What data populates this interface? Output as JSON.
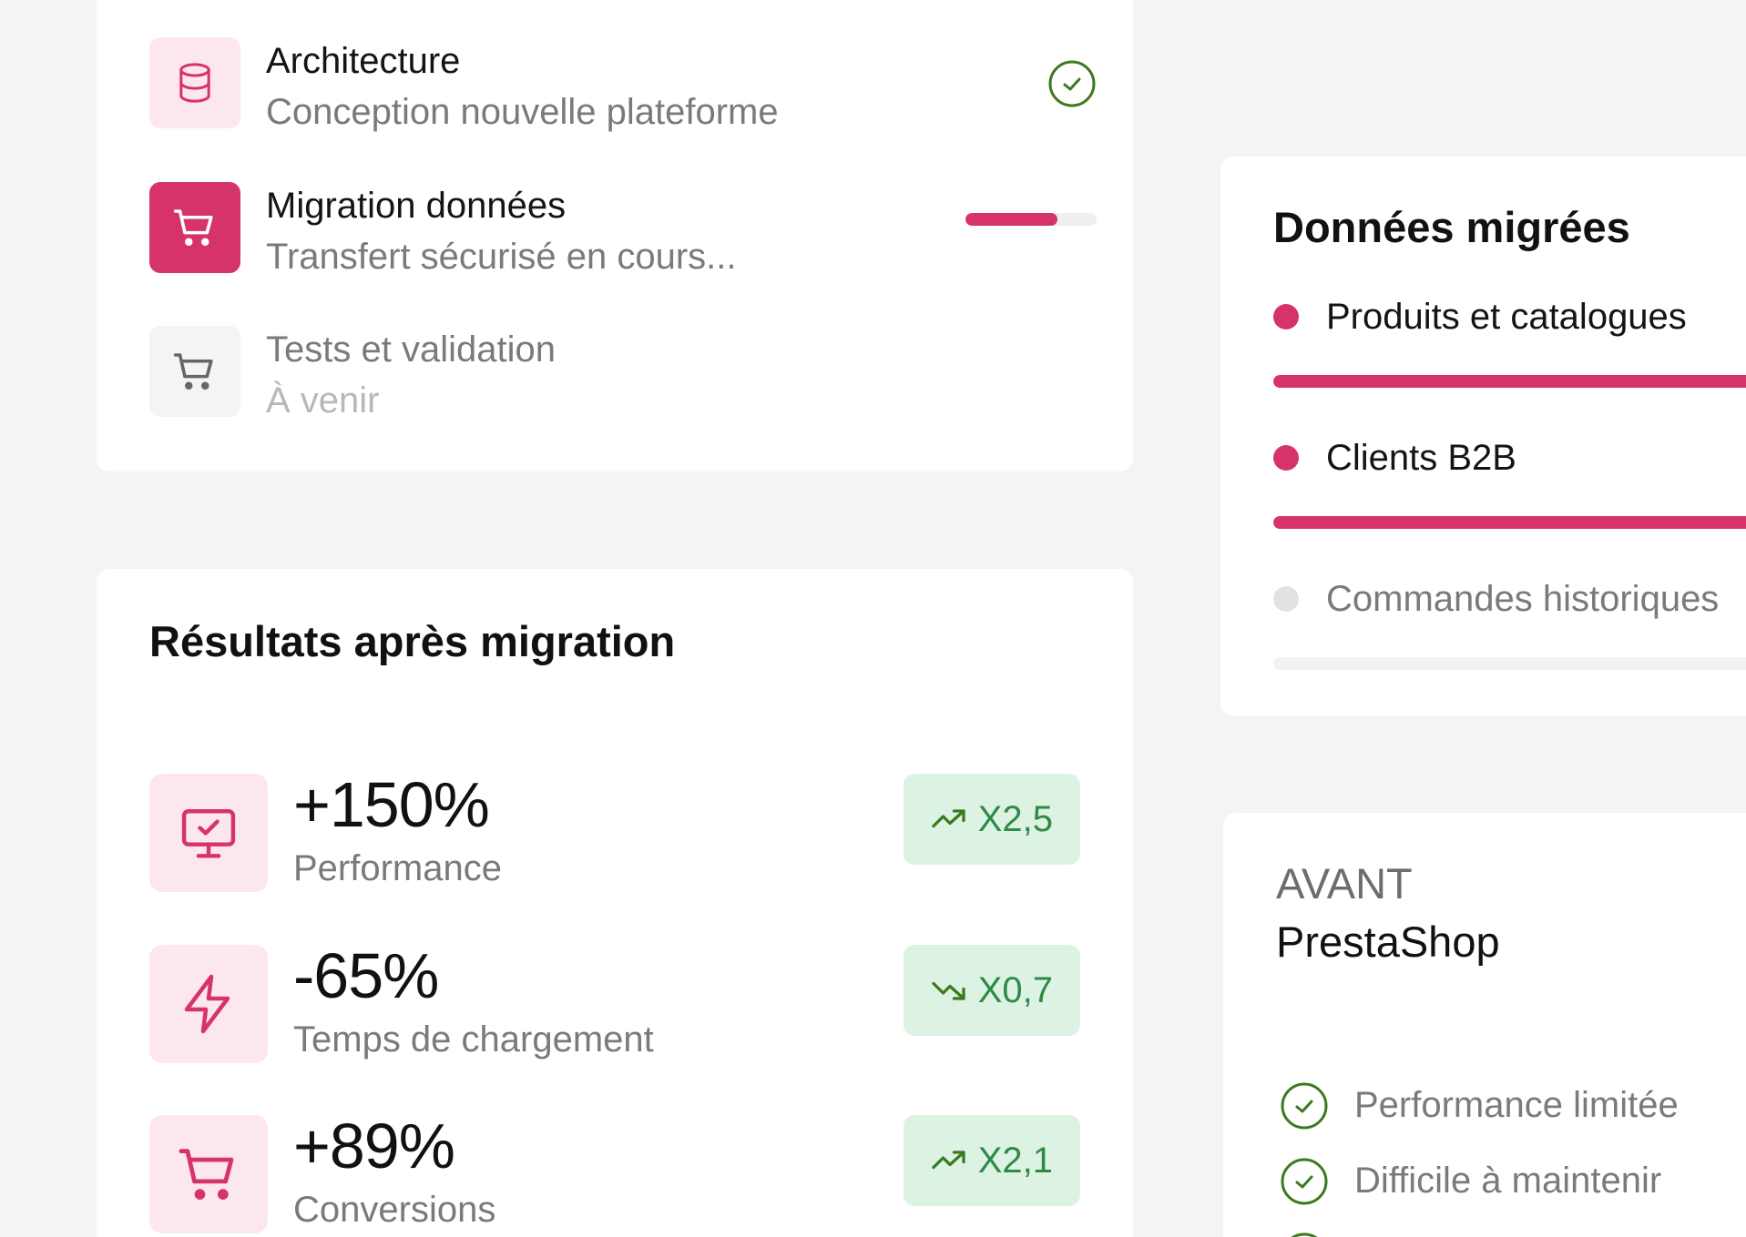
{
  "steps": [
    {
      "title": "Architecture",
      "subtitle": "Conception nouvelle plateforme",
      "state": "done",
      "icon": "database-icon"
    },
    {
      "title": "Migration données",
      "subtitle": "Transfert sécurisé en cours...",
      "state": "active",
      "progress": 0.7,
      "icon": "cart-icon"
    },
    {
      "title": "Tests et validation",
      "subtitle": "À venir",
      "state": "pending",
      "icon": "cart-icon"
    }
  ],
  "results": {
    "title": "Résultats après migration",
    "metrics": [
      {
        "value": "+150%",
        "label": "Performance",
        "badge": "X2,5",
        "trend": "up",
        "icon": "monitor-check-icon"
      },
      {
        "value": "-65%",
        "label": "Temps de chargement",
        "badge": "X0,7",
        "trend": "down",
        "icon": "lightning-icon"
      },
      {
        "value": "+89%",
        "label": "Conversions",
        "badge": "X2,1",
        "trend": "up",
        "icon": "cart-icon"
      }
    ]
  },
  "data_migrated": {
    "title": "Données migrées",
    "items": [
      {
        "label": "Produits et catalogues",
        "progress": 1.0,
        "active": true
      },
      {
        "label": "Clients B2B",
        "progress": 1.0,
        "active": true
      },
      {
        "label": "Commandes historiques",
        "progress": 0.0,
        "active": false
      }
    ]
  },
  "before": {
    "tag": "AVANT",
    "platform": "PrestaShop",
    "points": [
      "Performance limitée",
      "Difficile à maintenir"
    ]
  },
  "colors": {
    "accent": "#d6336c",
    "accent_light": "#fde7ee",
    "success": "#3b7a1e",
    "badge_bg": "#dcf3e4",
    "badge_text": "#2f8a46"
  }
}
